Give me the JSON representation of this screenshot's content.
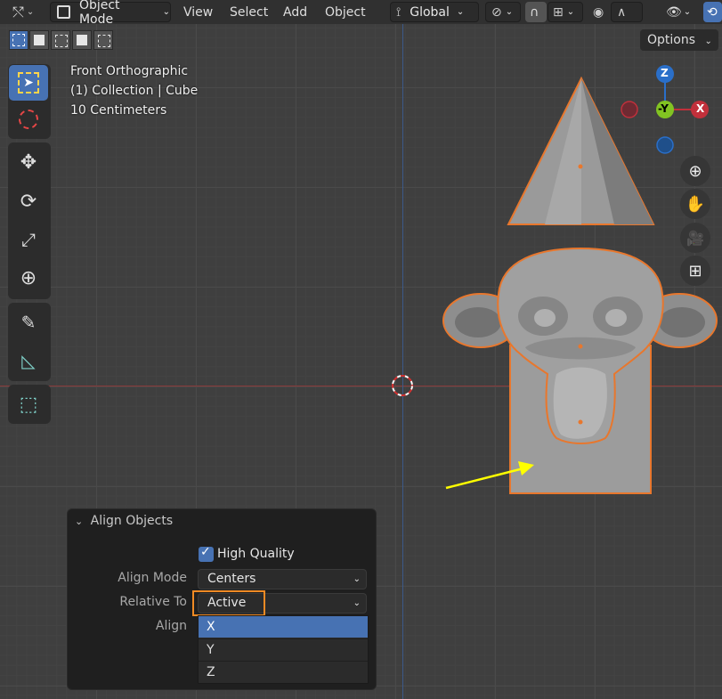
{
  "header": {
    "mode": "Object Mode",
    "menus": [
      "View",
      "Select",
      "Add",
      "Object"
    ],
    "orientation": "Global"
  },
  "options_label": "Options",
  "viewport_info": {
    "view": "Front Orthographic",
    "collection": "(1) Collection | Cube",
    "scale": "10 Centimeters"
  },
  "gizmo": {
    "z": "Z",
    "y": "-Y",
    "x": "X"
  },
  "panel": {
    "title": "Align Objects",
    "high_quality_label": "High Quality",
    "high_quality_checked": true,
    "align_mode_label": "Align Mode",
    "align_mode_value": "Centers",
    "relative_to_label": "Relative To",
    "relative_to_value": "Active",
    "align_label": "Align",
    "align_options": [
      "X",
      "Y",
      "Z"
    ],
    "align_selected": "X"
  },
  "colors": {
    "accent_blue": "#4772b3",
    "selection_orange": "#e8772d",
    "x_axis": "#c1303b",
    "y_axis": "#82c322",
    "z_axis": "#2a6fc9",
    "highlight_box": "#f08a24",
    "arrow": "#ffff00"
  }
}
